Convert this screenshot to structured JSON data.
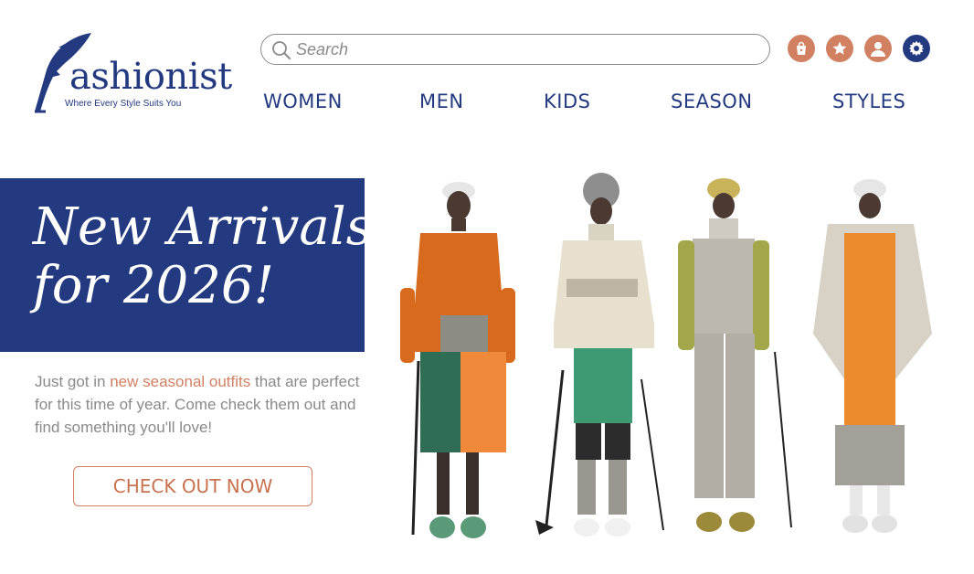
{
  "brand": {
    "name": "ashionist",
    "tagline": "Where Every Style Suits You",
    "primary_color": "#233a80",
    "accent_color": "#d28062"
  },
  "search": {
    "placeholder": "Search",
    "value": ""
  },
  "header_icons": [
    {
      "name": "shopping-bag-icon"
    },
    {
      "name": "star-icon"
    },
    {
      "name": "account-icon"
    },
    {
      "name": "settings-icon"
    }
  ],
  "nav": {
    "women": "WOMEN",
    "men": "MEN",
    "kids": "KIDS",
    "season": "SEASON",
    "styles": "STYLES"
  },
  "hero": {
    "title_line1": "New Arrivals",
    "title_line2": "for 2026!",
    "desc_before": "Just got in ",
    "desc_highlight": "new seasonal outfits",
    "desc_after": " that are perfect for this time of year. Come check them out and find something you'll love!",
    "cta_label": "CHECK OUT NOW"
  }
}
